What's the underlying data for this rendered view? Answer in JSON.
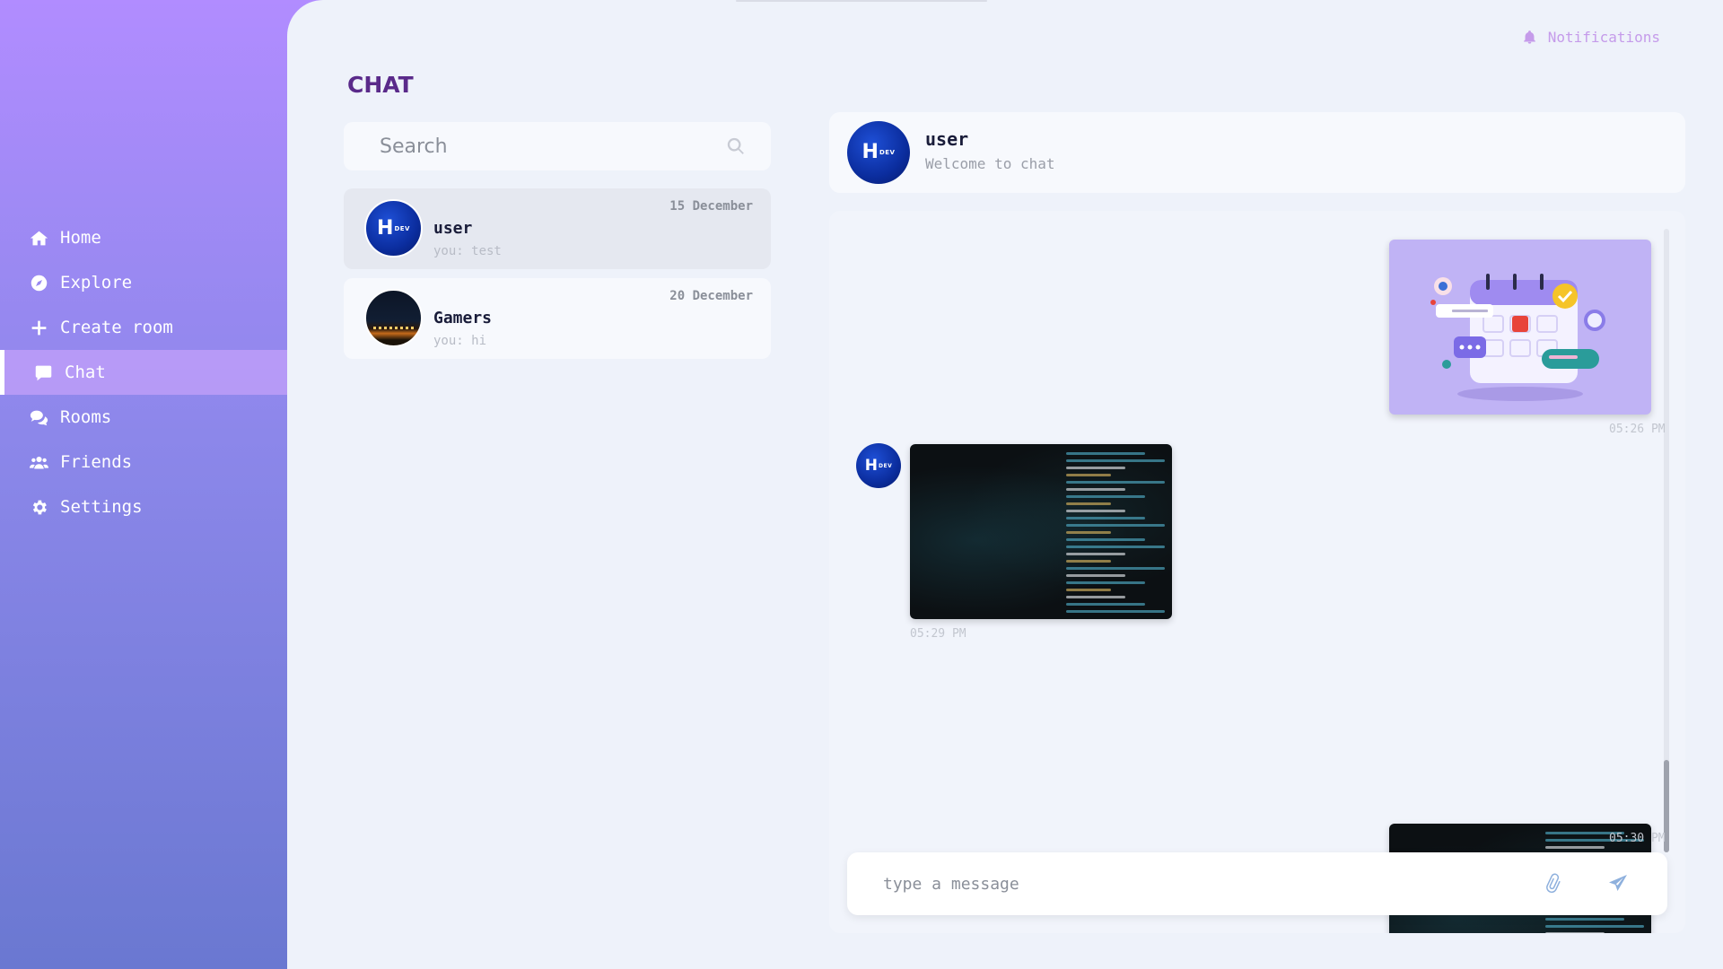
{
  "sidebar": {
    "items": [
      {
        "label": "Home",
        "icon": "home-icon"
      },
      {
        "label": "Explore",
        "icon": "compass-icon"
      },
      {
        "label": "Create room",
        "icon": "plus-icon"
      },
      {
        "label": "Chat",
        "icon": "chat-bubble-icon",
        "active": true
      },
      {
        "label": "Rooms",
        "icon": "comments-icon"
      },
      {
        "label": "Friends",
        "icon": "users-icon"
      },
      {
        "label": "Settings",
        "icon": "gear-icon"
      }
    ]
  },
  "header": {
    "notifications_label": "Notifications",
    "page_title": "CHAT"
  },
  "search": {
    "placeholder": "Search"
  },
  "conversations": [
    {
      "name": "user",
      "preview": "you: test",
      "date": "15 December",
      "selected": true,
      "avatar": "dev-logo"
    },
    {
      "name": "Gamers",
      "preview": "you: hi",
      "date": "20 December",
      "selected": false,
      "avatar": "city-night"
    }
  ],
  "avatar_logo": {
    "big": "H",
    "small": "DEV"
  },
  "chat": {
    "title": "user",
    "subtitle": "Welcome to chat",
    "messages": [
      {
        "side": "right",
        "type": "image",
        "image": "calendar-illustration",
        "time": "05:26 PM"
      },
      {
        "side": "left",
        "type": "image",
        "image": "code-screen",
        "time": "05:29 PM"
      },
      {
        "side": "right",
        "type": "image",
        "image": "code-screen",
        "time": "05:30 PM"
      }
    ],
    "composer_placeholder": "type a message"
  },
  "colors": {
    "sidebar_top": "#b18cff",
    "sidebar_bottom": "#6a78d1",
    "main_bg": "#eef2fa",
    "title": "#5a2a8a",
    "notification": "#c59bea",
    "accent_icon": "#8eb0dd"
  }
}
